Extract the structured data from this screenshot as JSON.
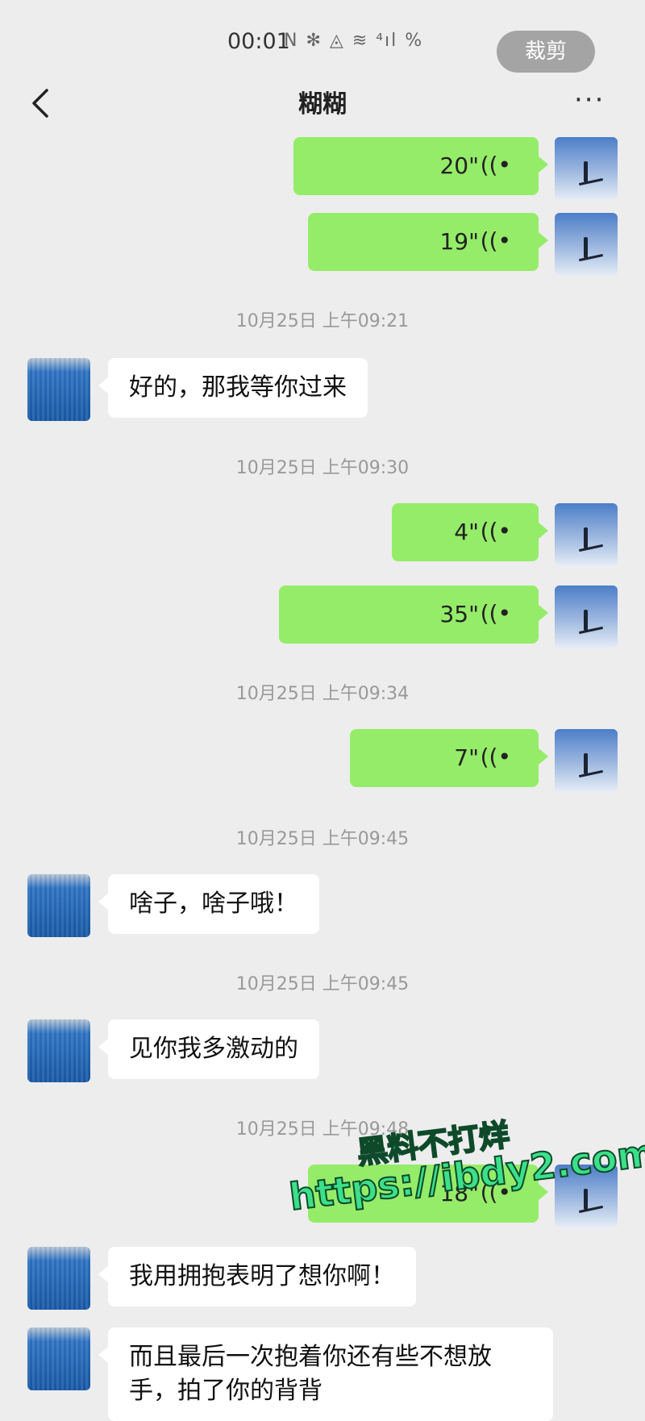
{
  "status_bar": {
    "time": "00:01",
    "icons": "N ✻ ◬ ≋ ⁴ıl %"
  },
  "crop_button": "裁剪",
  "header": {
    "title": "糊糊",
    "more": "···"
  },
  "messages": [
    {
      "type": "voice",
      "side": "me",
      "duration": "20\""
    },
    {
      "type": "voice",
      "side": "me",
      "duration": "19\""
    },
    {
      "type": "time",
      "text": "10月25日 上午09:21"
    },
    {
      "type": "text",
      "side": "them",
      "text": "好的，那我等你过来"
    },
    {
      "type": "time",
      "text": "10月25日 上午09:30"
    },
    {
      "type": "voice",
      "side": "me",
      "duration": "4\""
    },
    {
      "type": "voice",
      "side": "me",
      "duration": "35\""
    },
    {
      "type": "time",
      "text": "10月25日 上午09:34"
    },
    {
      "type": "voice",
      "side": "me",
      "duration": "7\""
    },
    {
      "type": "time",
      "text": "10月25日 上午09:45"
    },
    {
      "type": "text",
      "side": "them",
      "text": "啥子，啥子哦！"
    },
    {
      "type": "time",
      "text": "10月25日 上午09:45"
    },
    {
      "type": "text",
      "side": "them",
      "text": "见你我多激动的"
    },
    {
      "type": "time",
      "text": "10月25日 上午09:48"
    },
    {
      "type": "voice",
      "side": "me",
      "duration": "18\""
    },
    {
      "type": "text",
      "side": "them",
      "text": "我用拥抱表明了想你啊！"
    },
    {
      "type": "text",
      "side": "them",
      "text": "而且最后一次抱着你还有些不想放手，拍了你的背背"
    }
  ],
  "voice_wave_glyph": "((•",
  "watermark": {
    "line1": "黑料不打烊",
    "line2": "https://ibdy2.com"
  }
}
